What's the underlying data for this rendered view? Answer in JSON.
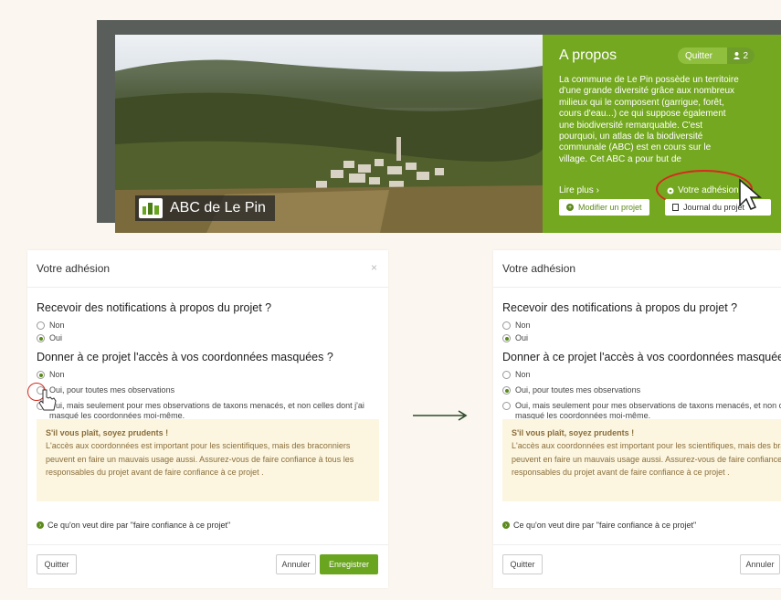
{
  "banner": {
    "project_name": "ABC de Le Pin",
    "about": {
      "title": "A propos",
      "quit_label": "Quitter",
      "member_count": "2",
      "text": "La commune de Le Pin possède un territoire d'une grande diversité grâce aux nombreux milieux qui le composent (garrigue, forêt, cours d'eau...) ce qui suppose également une biodiversité remarquable. C'est pourquoi, un atlas de la biodiversité communale (ABC) est en cours sur le village. Cet ABC a pour but de",
      "read_more": "Lire plus ›",
      "membership_link": "Votre adhésion",
      "edit_project": "Modifier un projet",
      "journal": "Journal du projet"
    }
  },
  "dialog_before": {
    "title": "Votre adhésion",
    "close": "×",
    "q1": "Recevoir des notifications à propos du projet ?",
    "q1_options": [
      "Non",
      "Oui"
    ],
    "q2": "Donner à ce projet l'accès à vos coordonnées masquées ?",
    "q2_options": [
      "Non",
      "Oui, pour toutes mes observations",
      "Oui, mais seulement pour mes observations de taxons menacés, et non celles dont j'ai masqué les coordonnées moi-même."
    ],
    "warning_title": "S'il vous plaît, soyez prudents !",
    "warning_text": "L'accès aux coordonnées est important pour les scientifiques, mais des braconniers peuvent en faire un mauvais usage aussi. Assurez-vous de faire confiance à tous les responsables du projet avant de faire confiance à ce projet .",
    "info_link": "Ce qu'on veut dire par \"faire confiance à ce projet\"",
    "quit": "Quitter",
    "cancel": "Annuler",
    "save": "Enregistrer"
  },
  "dialog_after": {
    "title": "Votre adhésion",
    "q1": "Recevoir des notifications à propos du projet ?",
    "q1_options": [
      "Non",
      "Oui"
    ],
    "q2": "Donner à ce projet l'accès à vos coordonnées masquées ?",
    "q2_options": [
      "Non",
      "Oui, pour toutes mes observations",
      "Oui, mais seulement pour mes observations de taxons menacés, et non celles dont j'ai masqué les coordonnées moi-même."
    ],
    "warning_title": "S'il vous plaît, soyez prudents !",
    "warning_text": "L'accès aux coordonnées est important pour les scientifiques, mais des braconniers peuvent en faire un mauvais usage aussi. Assurez-vous de faire confiance à tous les responsables du projet avant de faire confiance à ce projet .",
    "info_link": "Ce qu'on veut dire par \"faire confiance à ce projet\"",
    "quit": "Quitter",
    "cancel": "Annuler"
  },
  "colors": {
    "accent_green": "#74a820",
    "highlight_red": "#d52b1e",
    "warning_bg": "#fcf6e0"
  }
}
